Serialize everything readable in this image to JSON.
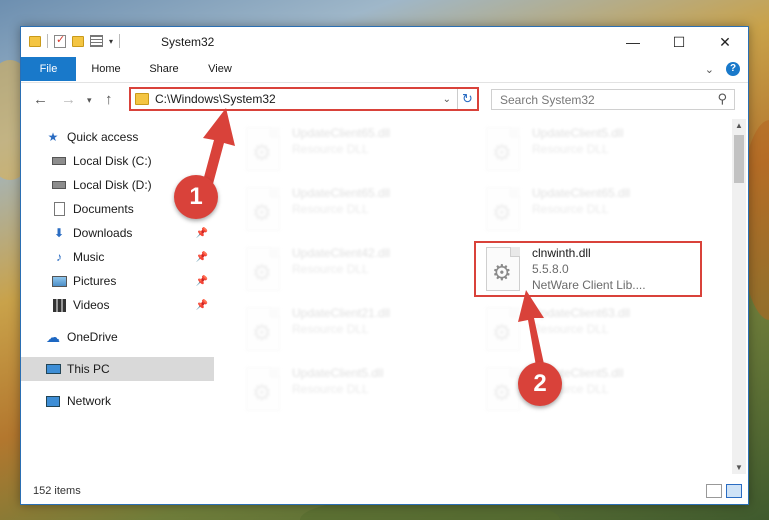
{
  "window": {
    "title": "System32",
    "controls": {
      "minimize": "—",
      "maximize": "☐",
      "close": "✕"
    }
  },
  "ribbon": {
    "tabs": [
      "File",
      "Home",
      "Share",
      "View"
    ],
    "help": "?"
  },
  "address_bar": {
    "path": "C:\\Windows\\System32"
  },
  "search": {
    "placeholder": "Search System32"
  },
  "nav_pane": {
    "items": [
      {
        "label": "Quick access",
        "icon": "star-icon"
      },
      {
        "label": "Local Disk (C:)",
        "icon": "drive-icon"
      },
      {
        "label": "Local Disk (D:)",
        "icon": "drive-icon"
      },
      {
        "label": "Documents",
        "icon": "documents-icon",
        "pinned": true
      },
      {
        "label": "Downloads",
        "icon": "download-icon",
        "pinned": true
      },
      {
        "label": "Music",
        "icon": "music-icon",
        "pinned": true
      },
      {
        "label": "Pictures",
        "icon": "pictures-icon",
        "pinned": true
      },
      {
        "label": "Videos",
        "icon": "videos-icon",
        "pinned": true
      },
      {
        "label": "OneDrive",
        "icon": "onedrive-icon"
      },
      {
        "label": "This PC",
        "icon": "pc-icon",
        "selected": true
      },
      {
        "label": "Network",
        "icon": "network-icon"
      }
    ]
  },
  "files": [
    {
      "name": "UpdateClient65.dll",
      "sub1": "Resource DLL",
      "sub2": ""
    },
    {
      "name": "UpdateClient5.dll",
      "sub1": "Resource DLL",
      "sub2": ""
    },
    {
      "name": "UpdateClient65.dll",
      "sub1": "Resource DLL",
      "sub2": ""
    },
    {
      "name": "UpdateClient65.dll",
      "sub1": "Resource DLL",
      "sub2": ""
    },
    {
      "name": "UpdateClient42.dll",
      "sub1": "Resource DLL",
      "sub2": ""
    },
    {
      "name": "clnwinth.dll",
      "sub1": "5.5.8.0",
      "sub2": "NetWare Client Lib...."
    },
    {
      "name": "UpdateClient21.dll",
      "sub1": "Resource DLL",
      "sub2": ""
    },
    {
      "name": "UpdateClient63.dll",
      "sub1": "Resource DLL",
      "sub2": ""
    },
    {
      "name": "UpdateClient5.dll",
      "sub1": "Resource DLL",
      "sub2": ""
    },
    {
      "name": "UpdateClient5.dll",
      "sub1": "Resource DLL",
      "sub2": ""
    }
  ],
  "status": {
    "item_count": "152 items"
  },
  "callouts": {
    "step1": "1",
    "step2": "2"
  },
  "colors": {
    "accent": "#1979ca",
    "highlight": "#d9423a"
  }
}
